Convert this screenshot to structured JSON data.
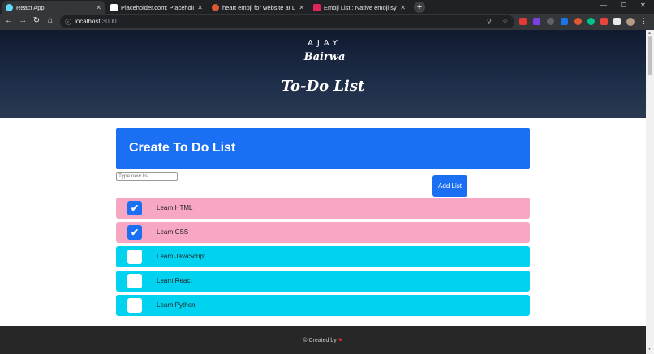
{
  "browser": {
    "tabs": [
      {
        "title": "React App",
        "favicon_color": "#61dafb",
        "active": true
      },
      {
        "title": "Placeholder.com: Placeholder.com",
        "favicon_color": "#ffffff",
        "active": false
      },
      {
        "title": "heart emoji for website at DuckD",
        "favicon_color": "#de5833",
        "active": false
      },
      {
        "title": "Emoji List : Native emoji symbols",
        "favicon_color": "#e0245e",
        "active": false
      }
    ],
    "new_tab": "+",
    "url_host": "localhost",
    "url_port": ":3000"
  },
  "hero": {
    "logo_top": "AJAY",
    "logo_script": "Bairwa",
    "title": "To-Do List"
  },
  "create": {
    "heading": "Create To Do List",
    "input_placeholder": "Type new list...",
    "input_value": "",
    "add_button": "Add List"
  },
  "todos": [
    {
      "label": "Learn HTML",
      "checked": true,
      "bg": "#f7a6c4"
    },
    {
      "label": "Learn CSS",
      "checked": true,
      "bg": "#f7a6c4"
    },
    {
      "label": "Learn JavaScript",
      "checked": false,
      "bg": "#00d2f0"
    },
    {
      "label": "Learn React",
      "checked": false,
      "bg": "#00d2f0"
    },
    {
      "label": "Learn Python",
      "checked": false,
      "bg": "#00d2f0"
    }
  ],
  "footer": {
    "credit": "© Created by",
    "heart": "❤"
  },
  "colors": {
    "primary": "#1b6ff2",
    "done_row": "#f7a6c4",
    "todo_row": "#00d2f0",
    "footer_bg": "#272727"
  }
}
